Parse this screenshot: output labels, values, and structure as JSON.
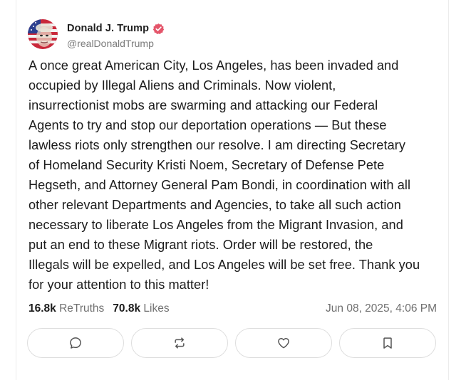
{
  "author": {
    "display_name": "Donald J. Trump",
    "handle": "@realDonaldTrump",
    "verified_icon": "verified-badge-icon",
    "verified_color": "#e4556a"
  },
  "post": {
    "text": "A once great American City, Los Angeles, has been invaded and\noccupied by Illegal Aliens and Criminals.  Now violent,\ninsurrectionist mobs are swarming and attacking our Federal\nAgents to try and stop our deportation operations — But these\nlawless riots only strengthen our resolve. I am directing Secretary\nof Homeland Security Kristi Noem, Secretary of Defense Pete\nHegseth, and Attorney General Pam Bondi, in coordination with all\nother relevant Departments and Agencies, to take all such action\nnecessary to liberate Los Angeles from the Migrant Invasion, and\nput an end to these Migrant riots. Order will be restored, the\nIllegals will be expelled, and Los Angeles will be set free. Thank you\nfor your attention to this matter!"
  },
  "stats": {
    "retruths_count": "16.8k",
    "retruths_label": "ReTruths",
    "likes_count": "70.8k",
    "likes_label": "Likes"
  },
  "timestamp": "Jun 08, 2025, 4:06 PM",
  "actions": [
    {
      "name": "reply-button",
      "icon": "comment-icon"
    },
    {
      "name": "retruth-button",
      "icon": "repost-icon"
    },
    {
      "name": "like-button",
      "icon": "heart-icon"
    },
    {
      "name": "bookmark-button",
      "icon": "bookmark-icon"
    }
  ]
}
